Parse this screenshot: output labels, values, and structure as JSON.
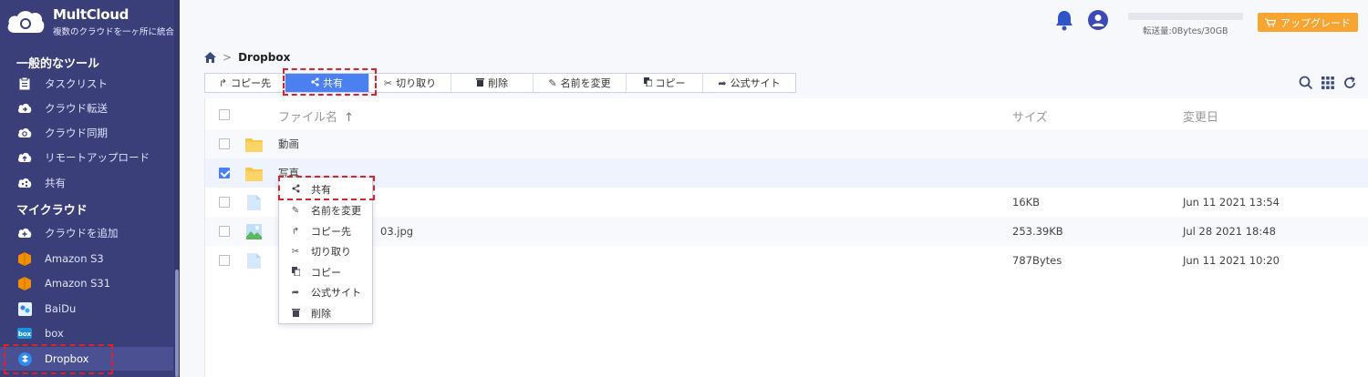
{
  "app": {
    "name": "MultCloud",
    "tagline": "複数のクラウドを一ヶ所に統合"
  },
  "sidebar": {
    "section_tools": "一般的なツール",
    "tools": [
      {
        "label": "タスクリスト",
        "icon": "clipboard-icon"
      },
      {
        "label": "クラウド転送",
        "icon": "cloud-transfer-icon"
      },
      {
        "label": "クラウド同期",
        "icon": "cloud-sync-icon"
      },
      {
        "label": "リモートアップロード",
        "icon": "remote-upload-icon"
      },
      {
        "label": "共有",
        "icon": "share-icon"
      }
    ],
    "section_clouds": "マイクラウド",
    "clouds": [
      {
        "label": "クラウドを追加",
        "icon": "cloud-add-icon"
      },
      {
        "label": "Amazon S3",
        "icon": "amazon-s3-icon"
      },
      {
        "label": "Amazon S31",
        "icon": "amazon-s3-icon"
      },
      {
        "label": "BaiDu",
        "icon": "baidu-icon"
      },
      {
        "label": "box",
        "icon": "box-icon"
      },
      {
        "label": "Dropbox",
        "icon": "dropbox-icon",
        "active": true
      }
    ]
  },
  "header": {
    "transfer_text": "転送量:0Bytes/30GB",
    "transfer_used": 0,
    "upgrade_label": "アップグレード"
  },
  "breadcrumb": {
    "current": "Dropbox"
  },
  "toolbar": {
    "copy_to": "コピー先",
    "share": "共有",
    "cut": "切り取り",
    "delete": "削除",
    "rename": "名前を変更",
    "copy": "コピー",
    "official_site": "公式サイト"
  },
  "table": {
    "col_name": "ファイル名",
    "col_size": "サイズ",
    "col_date": "変更日",
    "rows": [
      {
        "name": "動画",
        "type": "folder",
        "size": "",
        "date": "",
        "checked": false
      },
      {
        "name": "写真",
        "type": "folder",
        "size": "",
        "date": "",
        "checked": true
      },
      {
        "name": "",
        "type": "file",
        "size": "16KB",
        "date": "Jun 11 2021 13:54",
        "checked": false
      },
      {
        "name": "03.jpg",
        "type": "image",
        "size": "253.39KB",
        "date": "Jul 28 2021 18:48",
        "checked": false
      },
      {
        "name": "",
        "type": "file",
        "size": "787Bytes",
        "date": "Jun 11 2021 10:20",
        "checked": false
      }
    ]
  },
  "context_menu": [
    {
      "label": "共有",
      "icon": "share-icon"
    },
    {
      "label": "名前を変更",
      "icon": "pencil-icon"
    },
    {
      "label": "コピー先",
      "icon": "copy-to-icon"
    },
    {
      "label": "切り取り",
      "icon": "scissors-icon"
    },
    {
      "label": "コピー",
      "icon": "copy-icon"
    },
    {
      "label": "公式サイト",
      "icon": "external-share-icon"
    },
    {
      "label": "削除",
      "icon": "trash-icon"
    }
  ],
  "colors": {
    "sidebar_bg": "#3a3f7a",
    "accent": "#4a80f0",
    "upgrade": "#f7a531",
    "highlight": "#e0202a",
    "folder": "#f9c54a"
  }
}
